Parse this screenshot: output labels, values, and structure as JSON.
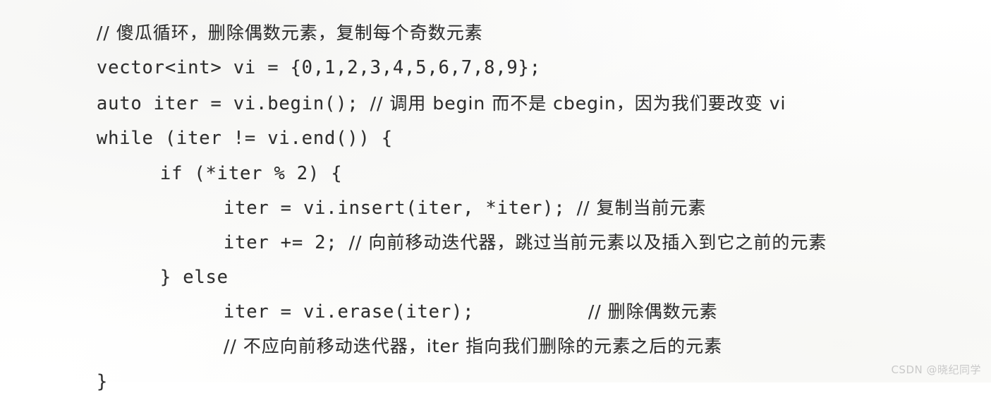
{
  "page": {
    "kind": "scanned-code-snippet",
    "background_color": "#fefefe",
    "text_color": "#2e2e2e",
    "watermark": "CSDN @晓纪同学",
    "watermark_color": "#c9c9c9"
  },
  "code": {
    "language": "C++",
    "lines": [
      {
        "indent": 0,
        "code": "",
        "comment": "// 傻瓜循环，删除偶数元素，复制每个奇数元素",
        "text": "// 傻瓜循环，删除偶数元素，复制每个奇数元素"
      },
      {
        "indent": 0,
        "code": "vector<int> vi = {0,1,2,3,4,5,6,7,8,9};",
        "comment": "",
        "text": "vector<int> vi = {0,1,2,3,4,5,6,7,8,9};"
      },
      {
        "indent": 0,
        "code": "auto iter = vi.begin();",
        "comment": "// 调用 begin 而不是 cbegin，因为我们要改变 vi",
        "text": "auto iter = vi.begin(); // 调用 begin 而不是 cbegin，因为我们要改变 vi"
      },
      {
        "indent": 0,
        "code": "while (iter != vi.end()) {",
        "comment": "",
        "text": "while (iter != vi.end()) {"
      },
      {
        "indent": 1,
        "code": "if (*iter % 2) {",
        "comment": "",
        "text": "if (*iter % 2) {"
      },
      {
        "indent": 2,
        "code": "iter = vi.insert(iter, *iter);",
        "comment": "// 复制当前元素",
        "text": "iter = vi.insert(iter, *iter); // 复制当前元素"
      },
      {
        "indent": 2,
        "code": "iter += 2;",
        "comment": "// 向前移动迭代器，跳过当前元素以及插入到它之前的元素",
        "text": "iter += 2; // 向前移动迭代器，跳过当前元素以及插入到它之前的元素"
      },
      {
        "indent": 1,
        "code": "} else",
        "comment": "",
        "text": "} else"
      },
      {
        "indent": 2,
        "code": "iter = vi.erase(iter);",
        "comment": "// 删除偶数元素",
        "text": "iter = vi.erase(iter);            // 删除偶数元素"
      },
      {
        "indent": 2,
        "code": "",
        "comment": "// 不应向前移动迭代器，iter 指向我们删除的元素之后的元素",
        "text": "// 不应向前移动迭代器，iter 指向我们删除的元素之后的元素"
      },
      {
        "indent": 0,
        "code": "}",
        "comment": "",
        "text": "}"
      }
    ]
  }
}
